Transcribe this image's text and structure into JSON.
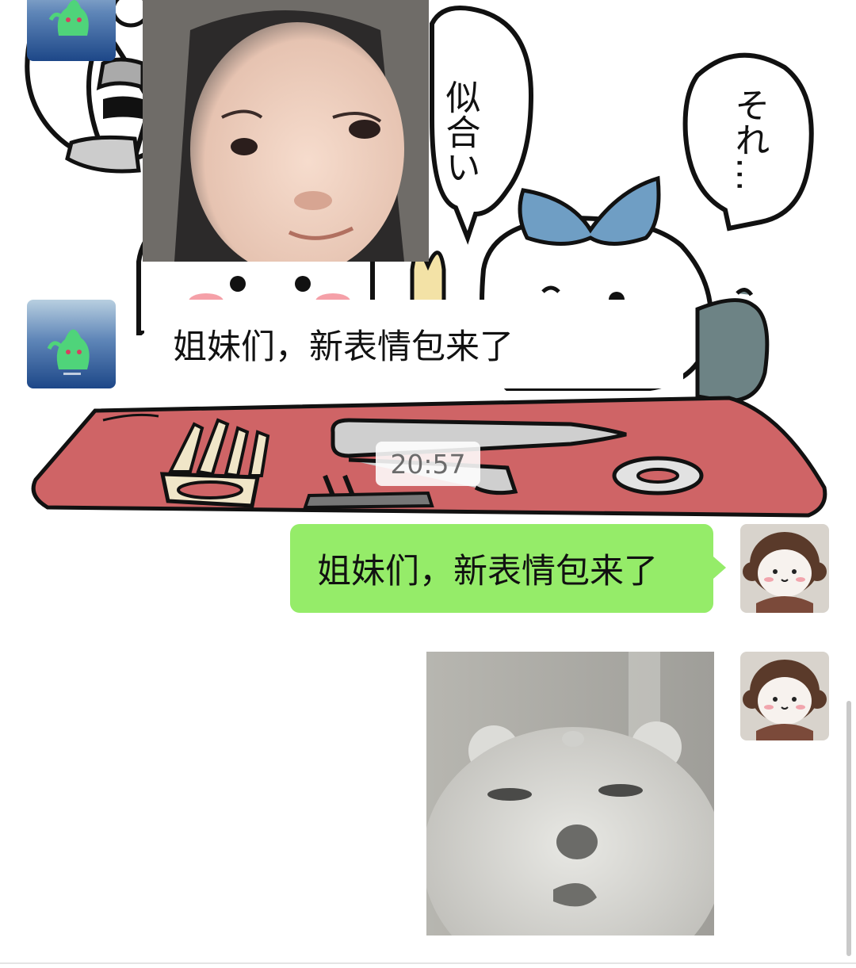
{
  "background": {
    "speech_bubble_left_text": "似合い",
    "speech_bubble_right_text": "それ…"
  },
  "messages": [
    {
      "type": "sticker",
      "side": "left",
      "avatar": "green-mascot-avatar",
      "description_icon": "child-face-sticker"
    },
    {
      "type": "text",
      "side": "left",
      "avatar": "green-mascot-avatar",
      "text": "姐妹们，新表情包来了"
    },
    {
      "type": "timestamp",
      "text": "20:57"
    },
    {
      "type": "text",
      "side": "right",
      "avatar": "plush-doll-avatar",
      "text": "姐妹们，新表情包来了"
    },
    {
      "type": "sticker",
      "side": "right",
      "avatar": "plush-doll-avatar",
      "description_icon": "blurry-bear-sticker"
    }
  ],
  "colors": {
    "outgoing_bubble": "#95ec69",
    "incoming_bubble": "#ffffff",
    "mat": "#cf6466",
    "cat_bow": "#6f9ec4"
  }
}
